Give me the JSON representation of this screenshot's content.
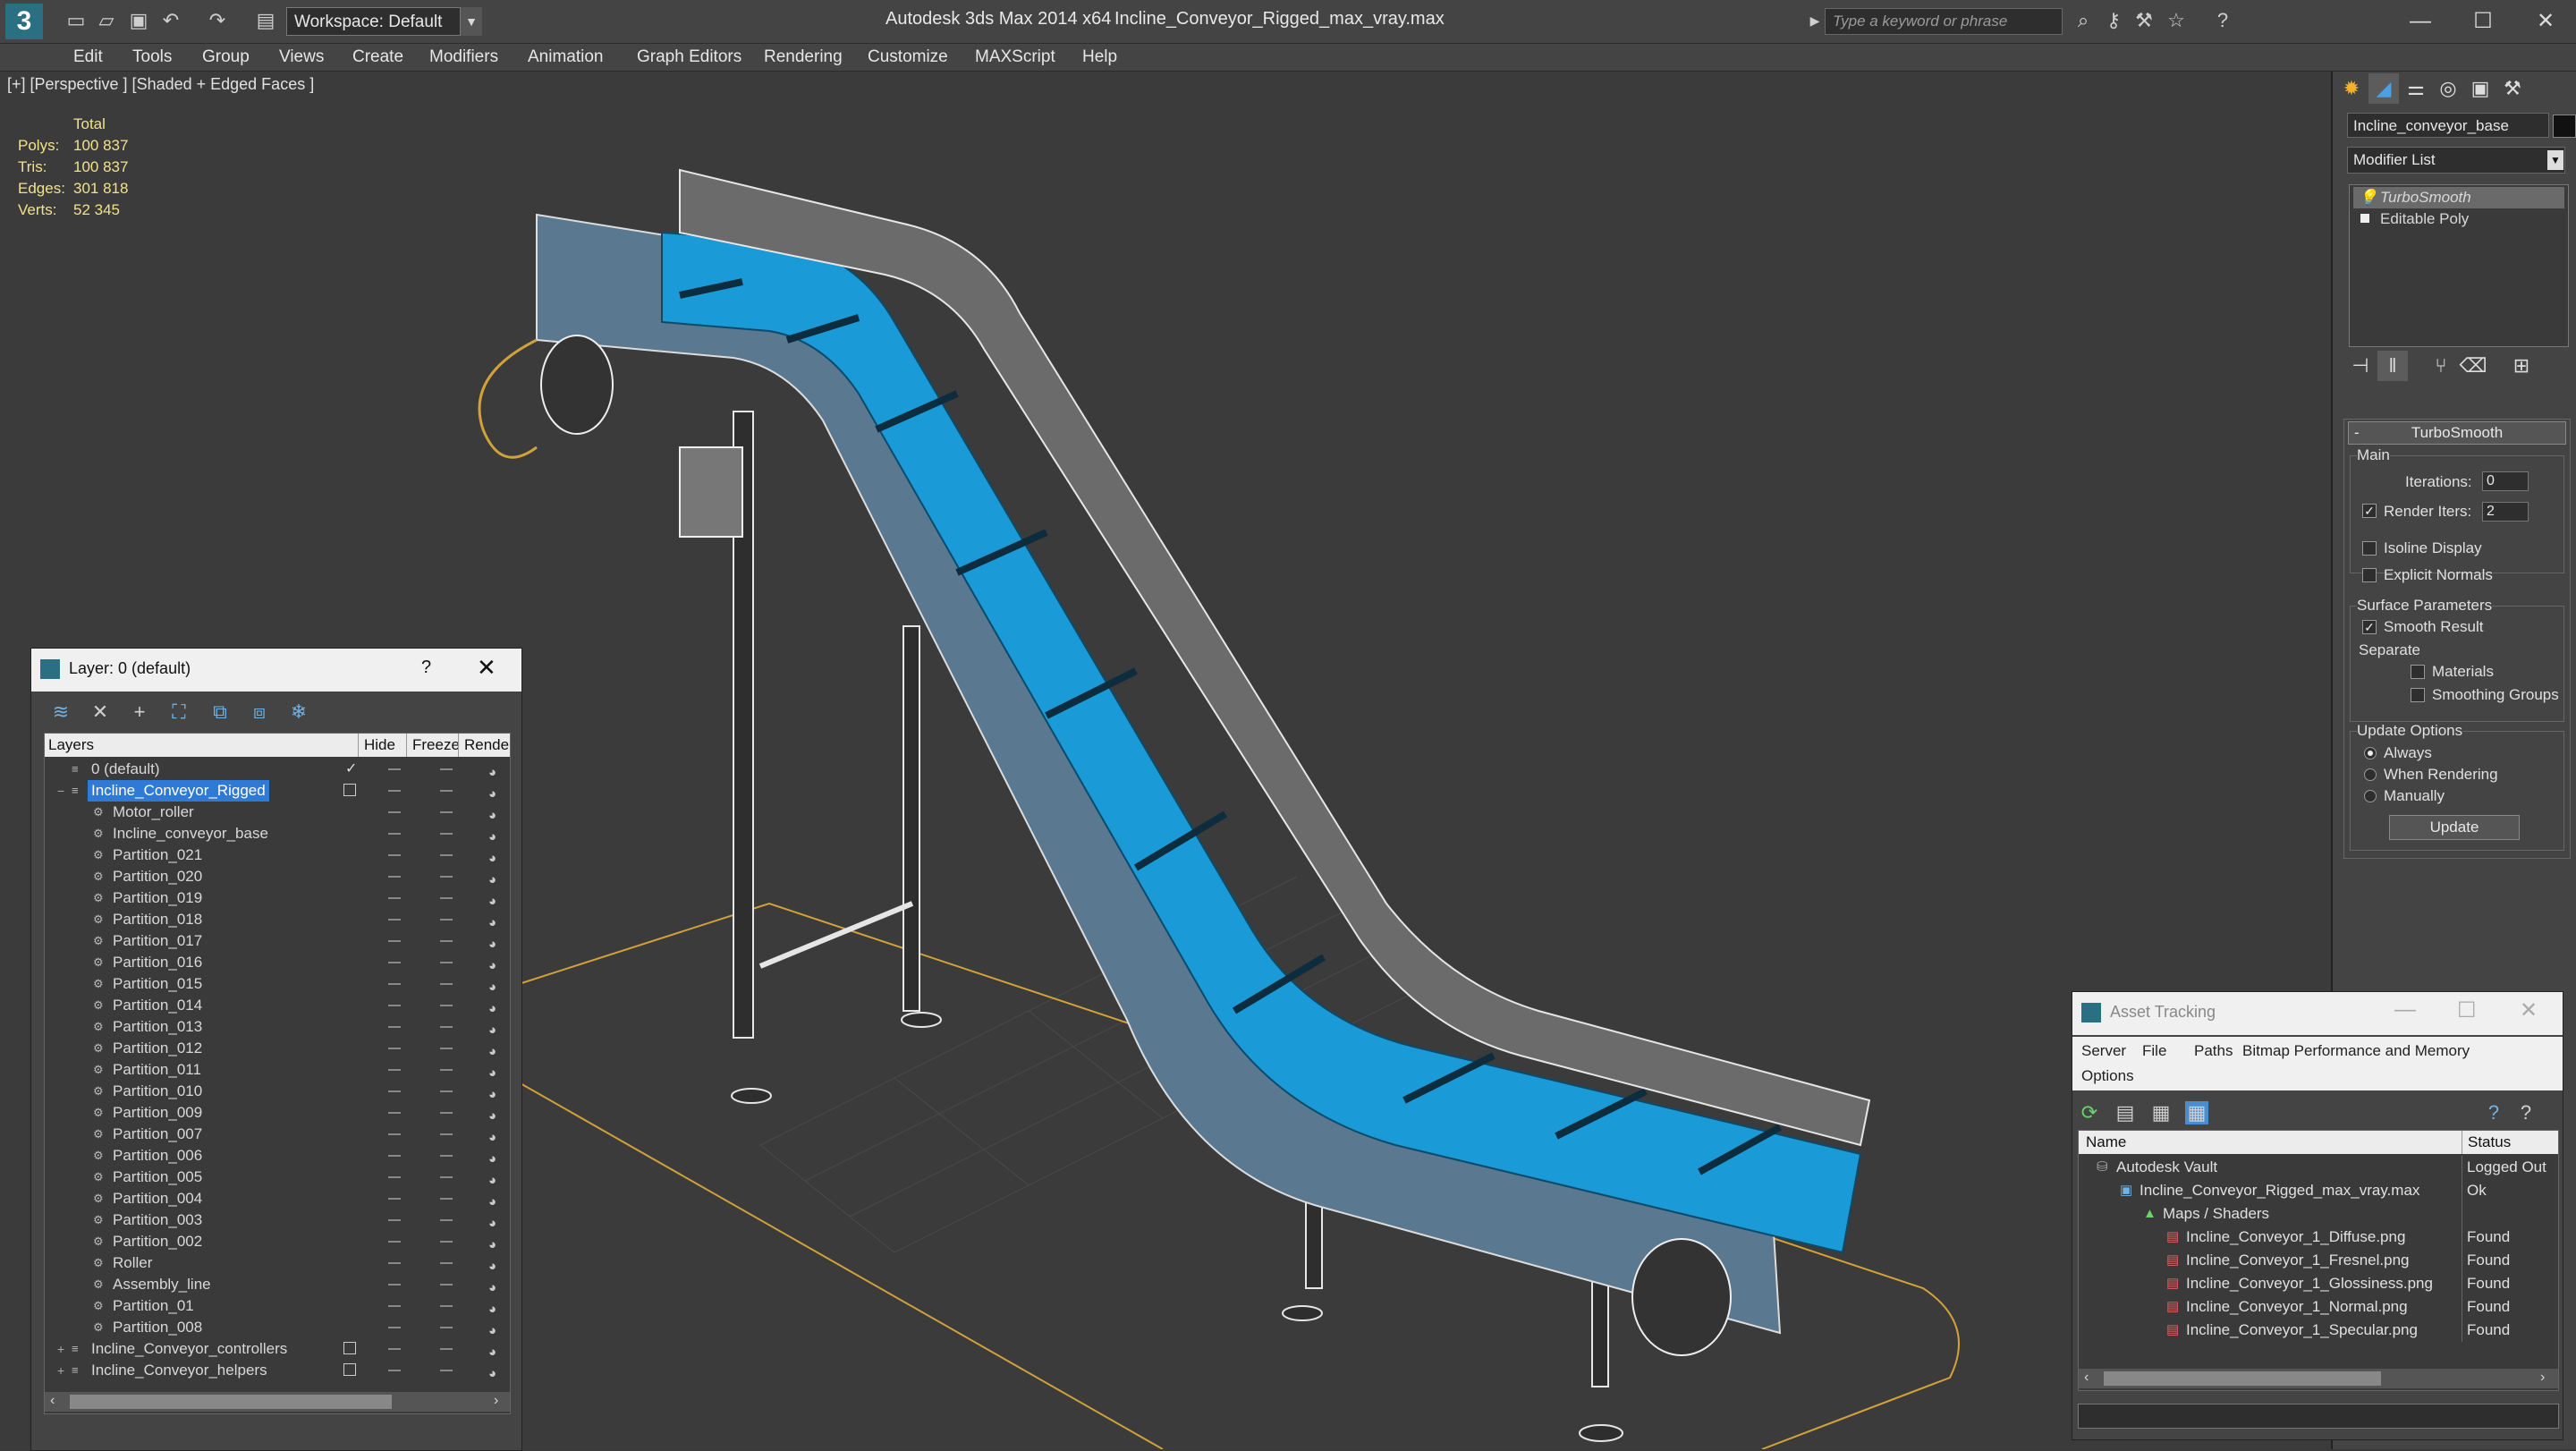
{
  "title_bar": {
    "app_title": "Autodesk 3ds Max 2014 x64",
    "file_title": "Incline_Conveyor_Rigged_max_vray.max",
    "workspace": "Workspace: Default",
    "search_placeholder": "Type a keyword or phrase"
  },
  "menu": [
    "Edit",
    "Tools",
    "Group",
    "Views",
    "Create",
    "Modifiers",
    "Animation",
    "Graph Editors",
    "Rendering",
    "Customize",
    "MAXScript",
    "Help"
  ],
  "viewport": {
    "label": "[+] [Perspective ] [Shaded + Edged Faces ]",
    "stats_header": "Total",
    "stats": [
      {
        "key": "Polys:",
        "value": "100 837"
      },
      {
        "key": "Tris:",
        "value": "100 837"
      },
      {
        "key": "Edges:",
        "value": "301 818"
      },
      {
        "key": "Verts:",
        "value": "52 345"
      }
    ]
  },
  "command_panel": {
    "object_name": "Incline_conveyor_base",
    "modifier_list": "Modifier List",
    "stack": [
      "TurboSmooth",
      "Editable Poly"
    ],
    "rollout_title": "TurboSmooth",
    "main_group": "Main",
    "iterations_label": "Iterations:",
    "iterations_value": "0",
    "render_iters_label": "Render Iters:",
    "render_iters_value": "2",
    "isoline_label": "Isoline Display",
    "explicit_normals_label": "Explicit Normals",
    "surface_group": "Surface Parameters",
    "smooth_result_label": "Smooth Result",
    "separate_label": "Separate",
    "materials_label": "Materials",
    "smoothing_groups_label": "Smoothing Groups",
    "update_group": "Update Options",
    "always_label": "Always",
    "when_rendering_label": "When Rendering",
    "manually_label": "Manually",
    "update_button": "Update"
  },
  "layer_dialog": {
    "title": "Layer: 0 (default)",
    "help": "?",
    "columns": {
      "layers": "Layers",
      "hide": "Hide",
      "freeze": "Freeze",
      "render": "Rende"
    },
    "rows": [
      {
        "name": "0 (default)",
        "level": 0,
        "type": "layer",
        "current": true
      },
      {
        "name": "Incline_Conveyor_Rigged",
        "level": 0,
        "type": "layer",
        "selected": true
      },
      {
        "name": "Motor_roller",
        "level": 1,
        "type": "object"
      },
      {
        "name": "Incline_conveyor_base",
        "level": 1,
        "type": "object"
      },
      {
        "name": "Partition_021",
        "level": 1,
        "type": "object"
      },
      {
        "name": "Partition_020",
        "level": 1,
        "type": "object"
      },
      {
        "name": "Partition_019",
        "level": 1,
        "type": "object"
      },
      {
        "name": "Partition_018",
        "level": 1,
        "type": "object"
      },
      {
        "name": "Partition_017",
        "level": 1,
        "type": "object"
      },
      {
        "name": "Partition_016",
        "level": 1,
        "type": "object"
      },
      {
        "name": "Partition_015",
        "level": 1,
        "type": "object"
      },
      {
        "name": "Partition_014",
        "level": 1,
        "type": "object"
      },
      {
        "name": "Partition_013",
        "level": 1,
        "type": "object"
      },
      {
        "name": "Partition_012",
        "level": 1,
        "type": "object"
      },
      {
        "name": "Partition_011",
        "level": 1,
        "type": "object"
      },
      {
        "name": "Partition_010",
        "level": 1,
        "type": "object"
      },
      {
        "name": "Partition_009",
        "level": 1,
        "type": "object"
      },
      {
        "name": "Partition_007",
        "level": 1,
        "type": "object"
      },
      {
        "name": "Partition_006",
        "level": 1,
        "type": "object"
      },
      {
        "name": "Partition_005",
        "level": 1,
        "type": "object"
      },
      {
        "name": "Partition_004",
        "level": 1,
        "type": "object"
      },
      {
        "name": "Partition_003",
        "level": 1,
        "type": "object"
      },
      {
        "name": "Partition_002",
        "level": 1,
        "type": "object"
      },
      {
        "name": "Roller",
        "level": 1,
        "type": "object"
      },
      {
        "name": "Assembly_line",
        "level": 1,
        "type": "object"
      },
      {
        "name": "Partition_01",
        "level": 1,
        "type": "object"
      },
      {
        "name": "Partition_008",
        "level": 1,
        "type": "object"
      },
      {
        "name": "Incline_Conveyor_controllers",
        "level": 0,
        "type": "layer"
      },
      {
        "name": "Incline_Conveyor_helpers",
        "level": 0,
        "type": "layer"
      }
    ]
  },
  "asset_tracking": {
    "title": "Asset Tracking",
    "menu": [
      "Server",
      "File",
      "Paths",
      "Bitmap Performance and Memory",
      "Options"
    ],
    "columns": {
      "name": "Name",
      "status": "Status"
    },
    "rows": [
      {
        "name": "Autodesk Vault",
        "status": "Logged Out",
        "level": 0
      },
      {
        "name": "Incline_Conveyor_Rigged_max_vray.max",
        "status": "Ok",
        "level": 1
      },
      {
        "name": "Maps / Shaders",
        "status": "",
        "level": 2
      },
      {
        "name": "Incline_Conveyor_1_Diffuse.png",
        "status": "Found",
        "level": 3
      },
      {
        "name": "Incline_Conveyor_1_Fresnel.png",
        "status": "Found",
        "level": 3
      },
      {
        "name": "Incline_Conveyor_1_Glossiness.png",
        "status": "Found",
        "level": 3
      },
      {
        "name": "Incline_Conveyor_1_Normal.png",
        "status": "Found",
        "level": 3
      },
      {
        "name": "Incline_Conveyor_1_Specular.png",
        "status": "Found",
        "level": 3
      }
    ]
  },
  "colors": {
    "belt_blue": "#1a9ad6",
    "selection_blue": "#2f7ad4",
    "stats_yellow": "#f1e28a",
    "grid_orange": "#d1a13a"
  }
}
